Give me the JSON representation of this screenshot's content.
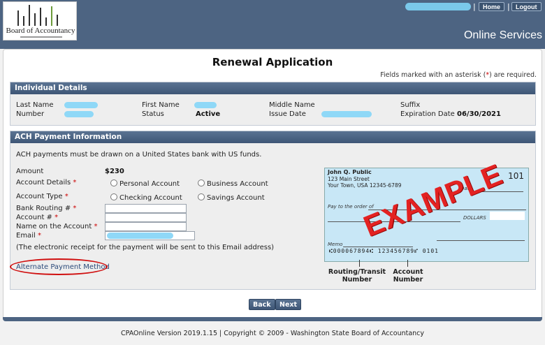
{
  "header": {
    "logo_text": "Board of Accountancy",
    "home_label": "Home",
    "logout_label": "Logout",
    "separator": "|",
    "online_services": "Online Services"
  },
  "page": {
    "title": "Renewal Application",
    "required_note_pre": "Fields marked with an asterisk (",
    "required_note_ast": "*",
    "required_note_post": ") are required."
  },
  "individual": {
    "heading": "Individual Details",
    "last_name_label": "Last Name",
    "number_label": "Number",
    "first_name_label": "First Name",
    "status_label": "Status",
    "status_value": "Active",
    "middle_name_label": "Middle Name",
    "issue_date_label": "Issue Date",
    "suffix_label": "Suffix",
    "expiration_label": "Expiration Date",
    "expiration_value": "06/30/2021"
  },
  "ach": {
    "heading": "ACH Payment Information",
    "notice": "ACH payments must be drawn on a United States bank with US funds.",
    "amount_label": "Amount",
    "amount_value": "$230",
    "account_details_label": "Account Details",
    "personal_account": "Personal Account",
    "business_account": "Business Account",
    "account_type_label": "Account Type",
    "checking_account": "Checking Account",
    "savings_account": "Savings Account",
    "routing_label": "Bank Routing #",
    "account_num_label": "Account #",
    "name_on_account_label": "Name on the Account",
    "email_label": "Email",
    "receipt_note": "(The electronic receipt for the payment will be sent to this Email address)",
    "alternate_link": "Alternate Payment Method",
    "asterisk": "*"
  },
  "check": {
    "name": "John Q. Public",
    "street": "123 Main Street",
    "city": "Your Town, USA  12345-6789",
    "number": "101",
    "date_label": "Date",
    "pay_to_label": "Pay to the order of",
    "dollars_label": "DOLLARS",
    "memo_label": "Memo",
    "micr": "⑆000067894⑆ 123456789⑈ 0101",
    "watermark": "EXAMPLE",
    "routing_caption_1": "Routing/Transit",
    "routing_caption_2": "Number",
    "account_caption_1": "Account",
    "account_caption_2": "Number"
  },
  "buttons": {
    "back": "Back",
    "next": "Next"
  },
  "footer": {
    "text": "CPAOnline Version 2019.1.15 | Copyright © 2009 - Washington State Board of Accountancy"
  },
  "colors": {
    "header_bg": "#4d6482",
    "section_head": "#3e5676",
    "required_red": "#cc0000",
    "annotation_red": "#d01010",
    "check_bg": "#c8e7f6",
    "redaction_blue": "#8fd8f7"
  }
}
